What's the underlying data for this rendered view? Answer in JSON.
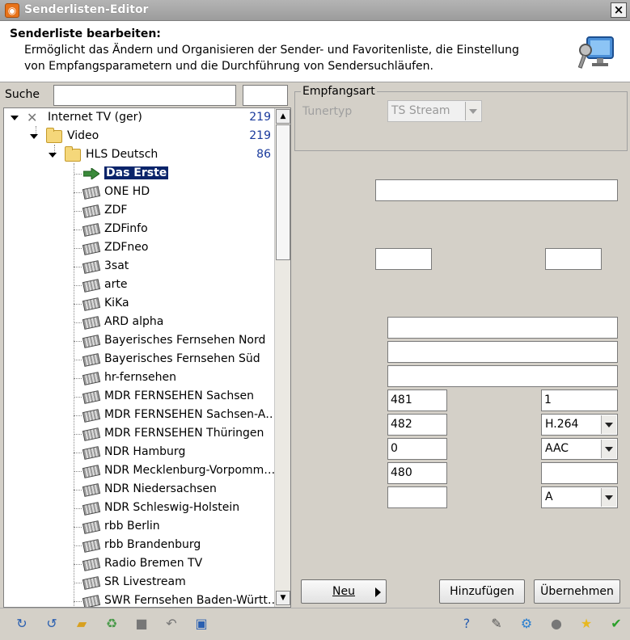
{
  "window": {
    "title": "Senderlisten-Editor"
  },
  "header": {
    "title": "Senderliste bearbeiten:",
    "description": "Ermöglicht das Ändern und Organisieren der Sender- und Favoritenliste, die Einstellung von Empfangsparametern und die Durchführung von Sendersuchläufen."
  },
  "search": {
    "label": "Suche",
    "value": "",
    "value2": ""
  },
  "tree": {
    "root": {
      "label": "Internet TV (ger)",
      "count": "219"
    },
    "folder1": {
      "label": "Video",
      "count": "219"
    },
    "folder2": {
      "label": "HLS Deutsch",
      "count": "86"
    },
    "channels": [
      "Das Erste",
      "ONE HD",
      "ZDF",
      "ZDFinfo",
      "ZDFneo",
      "3sat",
      "arte",
      "KiKa",
      "ARD alpha",
      "Bayerisches Fernsehen Nord",
      "Bayerisches Fernsehen Süd",
      "hr-fernsehen",
      "MDR FERNSEHEN Sachsen",
      "MDR FERNSEHEN Sachsen-A…",
      "MDR FERNSEHEN Thüringen",
      "NDR Hamburg",
      "NDR Mecklenburg-Vorpomm…",
      "NDR Niedersachsen",
      "NDR Schleswig-Holstein",
      "rbb Berlin",
      "rbb Brandenburg",
      "Radio Bremen TV",
      "SR Livestream",
      "SWR Fernsehen Baden-Württ…"
    ],
    "selected_index": 0
  },
  "reception": {
    "group_title": "Empfangsart",
    "tuner_label": "Tunertyp",
    "tuner_value": "TS Stream"
  },
  "fields": {
    "f481": "481",
    "f482": "482",
    "f0": "0",
    "f480": "480",
    "f1": "1",
    "codec_video": "H.264",
    "codec_audio": "AAC",
    "mode": "A"
  },
  "buttons": {
    "new": "Neu",
    "add": "Hinzufügen",
    "apply": "Übernehmen"
  },
  "colors": {
    "selection": "#0a246a",
    "count": "#1a3a9c"
  }
}
